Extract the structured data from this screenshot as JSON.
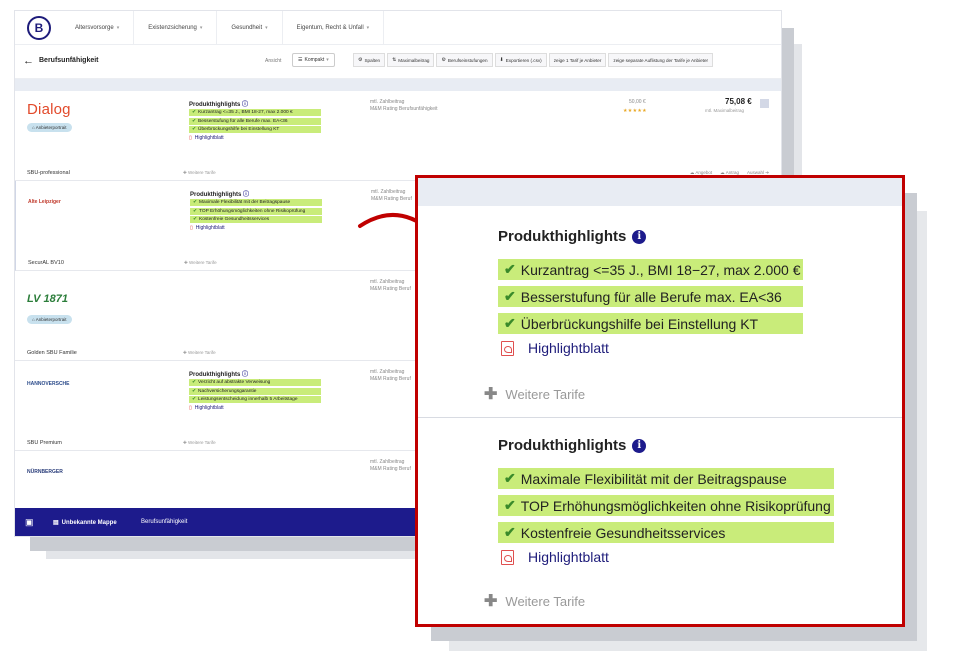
{
  "nav": {
    "logo": "B",
    "items": [
      {
        "label": "Altersvorsorge"
      },
      {
        "label": "Existenzsicherung"
      },
      {
        "label": "Gesundheit"
      },
      {
        "label": "Eigentum, Recht & Unfall"
      }
    ]
  },
  "subbar": {
    "title": "Berufsunfähigkeit",
    "ansicht_label": "Ansicht",
    "view_mode": "Kompakt",
    "toolbar": [
      {
        "label": "Spalten",
        "icon": "gear-icon"
      },
      {
        "label": "Maximalbeitrag",
        "icon": "sort-icon"
      },
      {
        "label": "Berufseinstufungen",
        "icon": "gears-icon"
      },
      {
        "label": "Exportieren (.csv)",
        "icon": "download-icon"
      },
      {
        "label": "zeige 1 Tarif je Anbieter",
        "icon": ""
      },
      {
        "label": "zeige separate Auflistung der Tarife je Anbieter",
        "icon": ""
      }
    ]
  },
  "rows": [
    {
      "insurer": "Dialog",
      "portrait_label": "Anbieterportrait",
      "tariff": "SBU-professional",
      "ph_title": "Produkthighlights",
      "highlights": [
        "Kurzantrag <=35 J., BMI 18-27, max 2.000 €",
        "Besserstufung für alle Berufe max. EA<36",
        "Überbrückungshilfe bei Einstellung KT"
      ],
      "highlightblatt": "Highlightblatt",
      "weitere": "Weitere Tarife",
      "zahl_label": "mtl. Zahlbeitrag",
      "rating_label": "M&M Rating Berufsunfähigkeit",
      "price_mid": "50,00 €",
      "stars": "★★★★★",
      "price_main": "75,08 €",
      "price_sub": "mtl. Maximalbeitrag",
      "actions": [
        "Angebot",
        "Antrag",
        "Auswahl"
      ]
    },
    {
      "insurer": "Alte Leipziger",
      "tariff": "SecurAL BV10",
      "ph_title": "Produkthighlights",
      "highlights": [
        "Maximale Flexibilität mit der Beitragspause",
        "TOP Erhöhungsmöglichkeiten ohne Risikoprüfung",
        "Kostenfreie Gesundheitsservices"
      ],
      "highlightblatt": "Highlightblatt",
      "weitere": "Weitere Tarife",
      "zahl_label": "mtl. Zahlbeitrag",
      "rating_label": "M&M Rating Beruf"
    },
    {
      "insurer": "LV 1871",
      "portrait_label": "Anbieterportrait",
      "tariff": "Golden SBU Familie",
      "weitere": "Weitere Tarife",
      "zahl_label": "mtl. Zahlbeitrag",
      "rating_label": "M&M Rating Beruf"
    },
    {
      "insurer": "HANNOVERSCHE",
      "tariff": "SBU Premium",
      "ph_title": "Produkthighlights",
      "highlights": [
        "Verzicht auf abstrakte Verweisung",
        "Nachversicherungsgarantie",
        "Leistungsentscheidung innerhalb 5 Arbeitstage"
      ],
      "highlightblatt": "Highlightblatt",
      "weitere": "Weitere Tarife",
      "zahl_label": "mtl. Zahlbeitrag",
      "rating_label": "M&M Rating Beruf"
    },
    {
      "insurer": "NÜRNBERGER",
      "zahl_label": "mtl. Zahlbeitrag",
      "rating_label": "M&M Rating Beruf"
    }
  ],
  "bottombar": {
    "mappe": "Unbekannte Mappe",
    "sparte": "Berufsunfähigkeit"
  },
  "zoom": {
    "sections": [
      {
        "title": "Produkthighlights",
        "highlights": [
          "Kurzantrag <=35 J., BMI 18−27, max 2.000 €",
          "Besserstufung für alle Berufe max. EA<36",
          "Überbrückungshilfe bei Einstellung KT"
        ],
        "highlightblatt": "Highlightblatt",
        "weitere": "Weitere Tarife"
      },
      {
        "title": "Produkthighlights",
        "highlights": [
          "Maximale Flexibilität mit der Beitragspause",
          "TOP Erhöhungsmöglichkeiten ohne Risikoprüfung",
          "Kostenfreie Gesundheitsservices"
        ],
        "highlightblatt": "Highlightblatt",
        "weitere": "Weitere Tarife"
      }
    ]
  },
  "colors": {
    "brand": "#1d1b8c",
    "highlight_bg": "#c9ec7a",
    "callout_border": "#c00000",
    "dialog_logo": "#e24a2b"
  }
}
